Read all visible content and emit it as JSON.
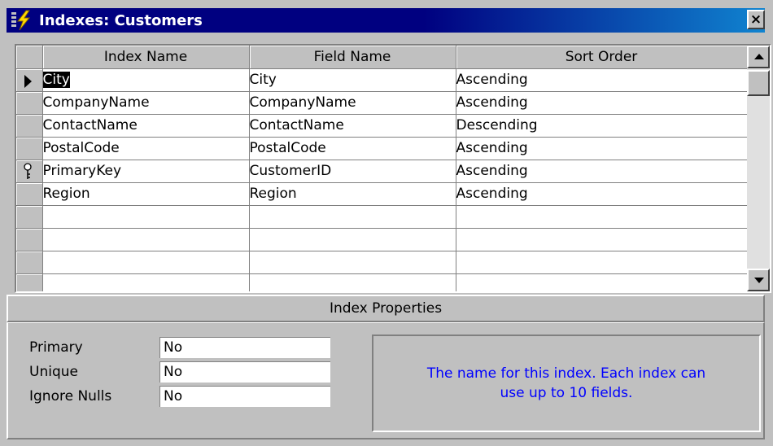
{
  "window": {
    "title": "Indexes: Customers",
    "close_label": "×",
    "app_icon": "lightning-icon"
  },
  "grid": {
    "columns": [
      "Index Name",
      "Field Name",
      "Sort Order"
    ],
    "rows": [
      {
        "index_name": "City",
        "field_name": "City",
        "sort_order": "Ascending",
        "selector": "current-row-arrow"
      },
      {
        "index_name": "CompanyName",
        "field_name": "CompanyName",
        "sort_order": "Ascending",
        "selector": ""
      },
      {
        "index_name": "ContactName",
        "field_name": "ContactName",
        "sort_order": "Descending",
        "selector": ""
      },
      {
        "index_name": "PostalCode",
        "field_name": "PostalCode",
        "sort_order": "Ascending",
        "selector": ""
      },
      {
        "index_name": "PrimaryKey",
        "field_name": "CustomerID",
        "sort_order": "Ascending",
        "selector": "primary-key-icon"
      },
      {
        "index_name": "Region",
        "field_name": "Region",
        "sort_order": "Ascending",
        "selector": ""
      },
      {
        "index_name": "",
        "field_name": "",
        "sort_order": "",
        "selector": ""
      },
      {
        "index_name": "",
        "field_name": "",
        "sort_order": "",
        "selector": ""
      },
      {
        "index_name": "",
        "field_name": "",
        "sort_order": "",
        "selector": ""
      },
      {
        "index_name": "",
        "field_name": "",
        "sort_order": "",
        "selector": ""
      }
    ]
  },
  "properties": {
    "header": "Index Properties",
    "items": [
      {
        "label": "Primary",
        "value": "No"
      },
      {
        "label": "Unique",
        "value": "No"
      },
      {
        "label": "Ignore Nulls",
        "value": "No"
      }
    ],
    "help_text": "The name for this index.  Each index can use up to 10 fields."
  },
  "colors": {
    "titlebar": "#000080",
    "help_text": "#0000ff",
    "face": "#c0c0c0"
  }
}
